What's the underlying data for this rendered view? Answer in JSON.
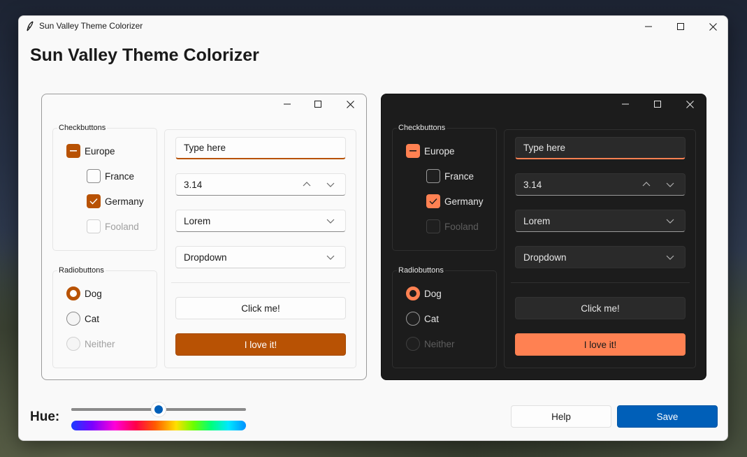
{
  "window": {
    "title": "Sun Valley Theme Colorizer",
    "heading": "Sun Valley Theme Colorizer"
  },
  "preview": {
    "checkbuttons_label": "Checkbuttons",
    "checkbuttons": [
      {
        "label": "Europe",
        "state": "indeterminate"
      },
      {
        "label": "France",
        "state": "unchecked"
      },
      {
        "label": "Germany",
        "state": "checked"
      },
      {
        "label": "Fooland",
        "state": "disabled"
      }
    ],
    "radiobuttons_label": "Radiobuttons",
    "radiobuttons": [
      {
        "label": "Dog",
        "state": "selected"
      },
      {
        "label": "Cat",
        "state": "unselected"
      },
      {
        "label": "Neither",
        "state": "disabled"
      }
    ],
    "entry_value": "Type here",
    "spinbox_value": "3.14",
    "combobox_value": "Lorem",
    "dropdown_value": "Dropdown",
    "button_label": "Click me!",
    "accent_button_label": "I love it!"
  },
  "controls": {
    "hue_label": "Hue:",
    "hue_value_fraction": 0.5,
    "help_label": "Help",
    "save_label": "Save"
  },
  "colors": {
    "light_accent": "#b85204",
    "dark_accent": "#ff8152",
    "system_accent": "#005fb8"
  },
  "icons": {
    "app": "feather-icon",
    "minimize": "minimize-icon",
    "maximize": "maximize-icon",
    "close": "close-icon"
  }
}
